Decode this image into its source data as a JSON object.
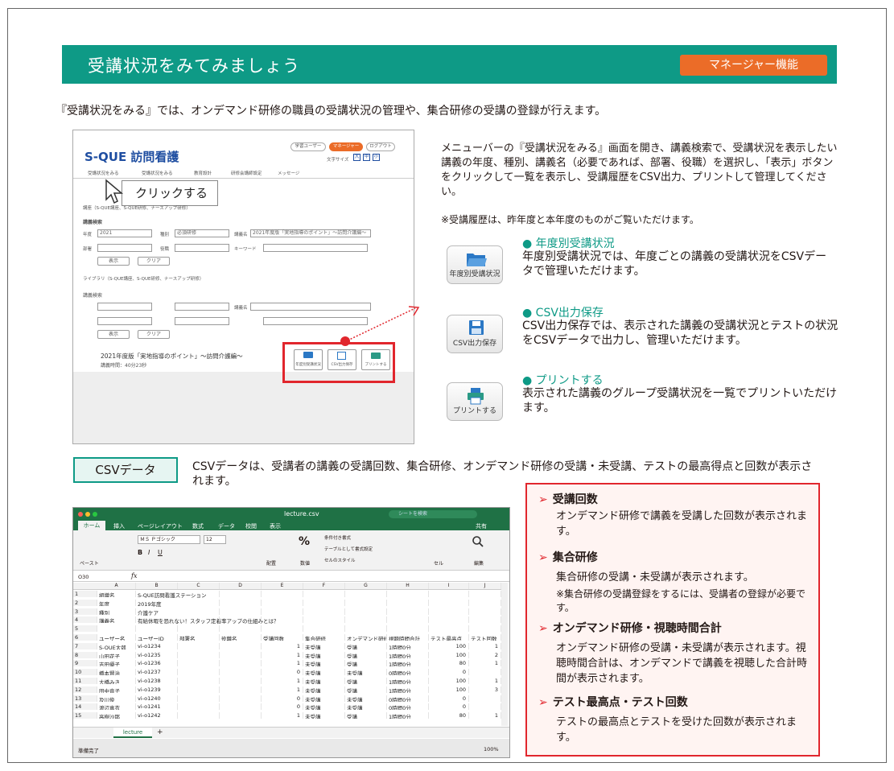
{
  "header": {
    "title": "受講状況をみてみましょう",
    "badge": "マネージャー機能"
  },
  "intro": "『受講状況をみる』では、オンデマンド研修の職員の受講状況の管理や、集合研修の受講の登録が行えます。",
  "app": {
    "logo": "S-QUE 訪問看護",
    "top_links": [
      "学習ユーザー",
      "マネージャー",
      "ログアウト"
    ],
    "font_size_label": "文字サイズ",
    "font_sizes": [
      "大",
      "中",
      "小"
    ],
    "nav": [
      "受講状況をみる",
      "受講状況をみる",
      "教育設計",
      "研修会講師設定",
      "メッセージ"
    ],
    "click_label": "クリックする",
    "section1_title": "講座（S-QUE講座、S-QUE研修、ナースアップ研修）",
    "search_title": "講義検索",
    "year_label": "年度",
    "year_value": "2021",
    "type_label": "種別",
    "type_value": "必須研修",
    "lecture_label": "講義名",
    "lecture_value": "2021年度版「実地指導のポイント」〜訪問介護編〜",
    "dept_label": "部署",
    "post_label": "役職",
    "keyword_label": "キーワード",
    "show_btn": "表示",
    "clear_btn": "クリア",
    "section2_title": "ライブラリ（S-QUE講座、S-QUE研修、ナースアップ研修）",
    "user_search_title": "講義検索",
    "user_lecture_label": "講義名",
    "result_title": "2021年度版「実地指導のポイント」〜訪問介護編〜",
    "result_time": "講義時間：40分23秒",
    "mini_buttons": [
      "年度別受講状況",
      "CSV出力保存",
      "プリントする"
    ]
  },
  "description": "メニューバーの『受講状況をみる』画面を開き、講義検索で、受講状況を表示したい講義の年度、種別、講義名（必要であれば、部署、役職）を選択し、「表示」ボタンをクリックして一覧を表示し、受講履歴をCSV出力、プリントして管理してください。",
  "description_note": "※受講履歴は、昨年度と本年度のものがご覧いただけます。",
  "features": [
    {
      "icon": "folder-icon",
      "button": "年度別受講状況",
      "title": "● 年度別受講状況",
      "text": "年度別受講状況では、年度ごとの講義の受講状況をCSVデータで管理いただけます。"
    },
    {
      "icon": "save-icon",
      "button": "CSV出力保存",
      "title": "● CSV出力保存",
      "text": "CSV出力保存では、表示された講義の受講状況とテストの状況をCSVデータで出力し、管理いただけます。"
    },
    {
      "icon": "printer-icon",
      "button": "プリントする",
      "title": "● プリントする",
      "text": "表示された講義のグループ受講状況を一覧でプリントいただけます。"
    }
  ],
  "csv": {
    "tag": "CSVデータ",
    "text": "CSVデータは、受講者の講義の受講回数、集合研修、オンデマンド研修の受講・未受講、テストの最高得点と回数が表示されます。"
  },
  "excel": {
    "title": "lecture.csv",
    "search_placeholder": "シートを検索",
    "tabs": [
      "ホーム",
      "挿入",
      "ページレイアウト",
      "数式",
      "データ",
      "校閲",
      "表示"
    ],
    "share": "共有",
    "font": "ＭＳ Ｐゴシック",
    "font_size": "12",
    "ribbon": [
      "条件付き書式",
      "テーブルとして書式設定",
      "セルのスタイル",
      "配置",
      "数値",
      "セル",
      "編集",
      "ペースト"
    ],
    "cell_ref": "O30",
    "fx": "fx",
    "col_letters": [
      "A",
      "B",
      "C",
      "D",
      "E",
      "F",
      "G",
      "H",
      "I",
      "J"
    ],
    "rows": [
      [
        "1",
        "組織名",
        "S-QUE訪問看護ステーション",
        "",
        "",
        "",
        "",
        "",
        "",
        "",
        ""
      ],
      [
        "2",
        "年度",
        "2019年度",
        "",
        "",
        "",
        "",
        "",
        "",
        "",
        ""
      ],
      [
        "3",
        "種別",
        "介護ケア",
        "",
        "",
        "",
        "",
        "",
        "",
        "",
        ""
      ],
      [
        "4",
        "講義名",
        "有給休暇を恐れない！スタッフ定着率アップの仕組みとは？",
        "",
        "",
        "",
        "",
        "",
        "",
        "",
        ""
      ],
      [
        "5",
        "",
        "",
        "",
        "",
        "",
        "",
        "",
        "",
        "",
        ""
      ],
      [
        "6",
        "ユーザー名",
        "ユーザーID",
        "部署名",
        "役職名",
        "受講回数",
        "集合研修",
        "オンデマンド研修",
        "視聴時間合計",
        "テスト最高点",
        "テスト回数"
      ],
      [
        "7",
        "S-QUE太郎",
        "vi-o1234",
        "",
        "",
        "1",
        "未受講",
        "受講",
        "1時間0分",
        "100",
        "1"
      ],
      [
        "8",
        "山田花子",
        "vi-o1235",
        "",
        "",
        "1",
        "未受講",
        "受講",
        "1時間0分",
        "100",
        "2"
      ],
      [
        "9",
        "吉田優子",
        "vi-o1236",
        "",
        "",
        "1",
        "未受講",
        "受講",
        "1時間0分",
        "80",
        "1"
      ],
      [
        "10",
        "橋本賢治",
        "vi-o1237",
        "",
        "",
        "0",
        "未受講",
        "未受講",
        "0時間0分",
        "0",
        ""
      ],
      [
        "11",
        "大橋みき",
        "vi-o1238",
        "",
        "",
        "1",
        "未受講",
        "受講",
        "1時間0分",
        "100",
        "1"
      ],
      [
        "12",
        "田中直子",
        "vi-o1239",
        "",
        "",
        "1",
        "未受講",
        "受講",
        "1時間0分",
        "100",
        "3"
      ],
      [
        "13",
        "及川俊",
        "vi-o1240",
        "",
        "",
        "0",
        "未受講",
        "未受講",
        "0時間0分",
        "0",
        ""
      ],
      [
        "14",
        "渡辺真衣",
        "vi-o1241",
        "",
        "",
        "0",
        "未受講",
        "未受講",
        "0時間0分",
        "0",
        ""
      ],
      [
        "15",
        "高樹沙耶",
        "vi-o1242",
        "",
        "",
        "1",
        "未受講",
        "受講",
        "1時間0分",
        "80",
        "1"
      ]
    ],
    "sheet_tab": "lecture",
    "status": "準備完了",
    "zoom": "100%"
  },
  "panel": [
    {
      "title": "受講回数",
      "text": "オンデマンド研修で講義を受講した回数が表示されます。"
    },
    {
      "title": "集合研修",
      "text": "集合研修の受講・未受講が表示されます。",
      "note": "※集合研修の受講登録をするには、受講者の登録が必要です。"
    },
    {
      "title": "オンデマンド研修・視聴時間合計",
      "text": "オンデマンド研修の受講・未受講が表示されます。視聴時間合計は、オンデマンドで講義を視聴した合計時間が表示されます。"
    },
    {
      "title": "テスト最高点・テスト回数",
      "text": "テストの最高点とテストを受けた回数が表示されます。"
    }
  ],
  "colors": {
    "teal": "#0e9a86",
    "orange": "#eb6c28",
    "red": "#e1262d",
    "excel_green": "#1f7145"
  }
}
